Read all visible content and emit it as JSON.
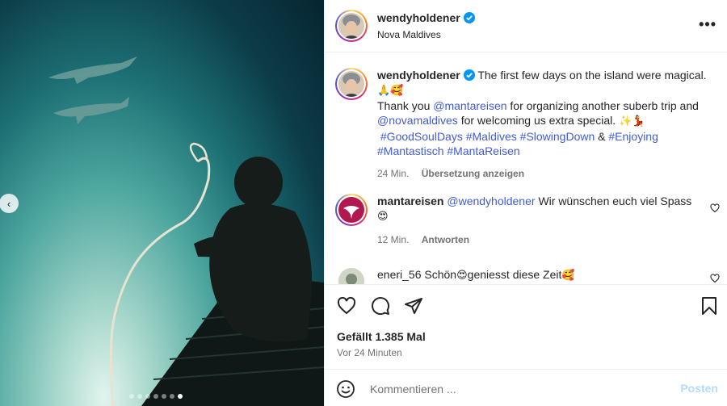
{
  "post": {
    "username": "wendyholdener",
    "location": "Nova Maldives",
    "more_label": "•••"
  },
  "carousel": {
    "prev_label": "‹",
    "dot_count": 7,
    "active_dot": 7
  },
  "caption": {
    "username": "wendyholdener",
    "text1": "The first few days on the island were magical.",
    "emoji1": "🙏🥰",
    "thank_you": "Thank you",
    "mention1": "@mantareisen",
    "text2": "for organizing another suberb trip and",
    "mention2": "@novamaldives",
    "text3": "for welcoming us extra special.",
    "emoji2": "✨💃",
    "tag1": "#GoodSoulDays",
    "tag2": "#Maldives",
    "tag3": "#SlowingDown",
    "amp": "&",
    "tag4": "#Enjoying",
    "tag5": "#Mantastisch",
    "tag6": "#MantaReisen",
    "time": "24 Min.",
    "translate": "Übersetzung anzeigen"
  },
  "comments": [
    {
      "username": "mantareisen",
      "mention": "@wendyholdener",
      "text": "Wir wünschen euch viel Spass",
      "emoji": "😍",
      "time": "12 Min.",
      "reply": "Antworten"
    },
    {
      "username": "eneri_56",
      "text_a": "Schön",
      "emoji_a": "😍",
      "text_b": "geniesst diese Zeit",
      "emoji_b": "🥰"
    }
  ],
  "likes": "Gefällt 1.385 Mal",
  "timestamp": "Vor 24 Minuten",
  "comment_box": {
    "placeholder": "Kommentieren ...",
    "post_label": "Posten"
  },
  "colors": {
    "link": "#3f5bd9",
    "post_disabled": "#b3dbff",
    "meta": "#737373"
  }
}
